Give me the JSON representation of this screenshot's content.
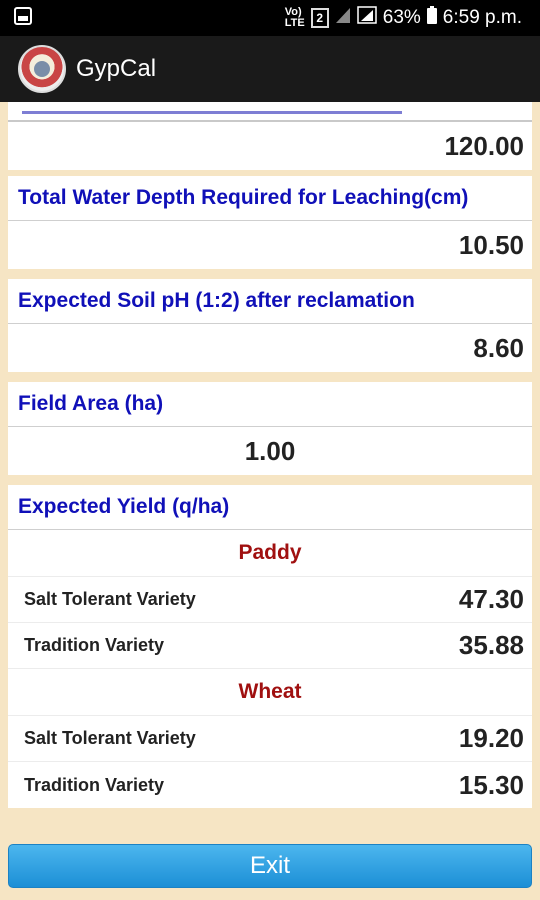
{
  "status_bar": {
    "volte_label": "Vo)\nLTE",
    "sim_label": "2",
    "battery": "63%",
    "time": "6:59 p.m."
  },
  "app_bar": {
    "title": "GypCal"
  },
  "results": {
    "gypsum_requirement_value": "120.00",
    "water_depth_label": "Total Water Depth Required for Leaching(cm)",
    "water_depth_value": "10.50",
    "soil_ph_label": "Expected Soil pH (1:2) after reclamation",
    "soil_ph_value": "8.60",
    "field_area_label": "Field Area (ha)",
    "field_area_value": "1.00"
  },
  "yield": {
    "label": "Expected Yield (q/ha)",
    "crops": [
      {
        "name": "Paddy",
        "rows": [
          {
            "label": "Salt Tolerant Variety",
            "value": "47.30"
          },
          {
            "label": "Tradition Variety",
            "value": "35.88"
          }
        ]
      },
      {
        "name": "Wheat",
        "rows": [
          {
            "label": "Salt Tolerant Variety",
            "value": "19.20"
          },
          {
            "label": "Tradition Variety",
            "value": "15.30"
          }
        ]
      }
    ]
  },
  "exit_label": "Exit"
}
